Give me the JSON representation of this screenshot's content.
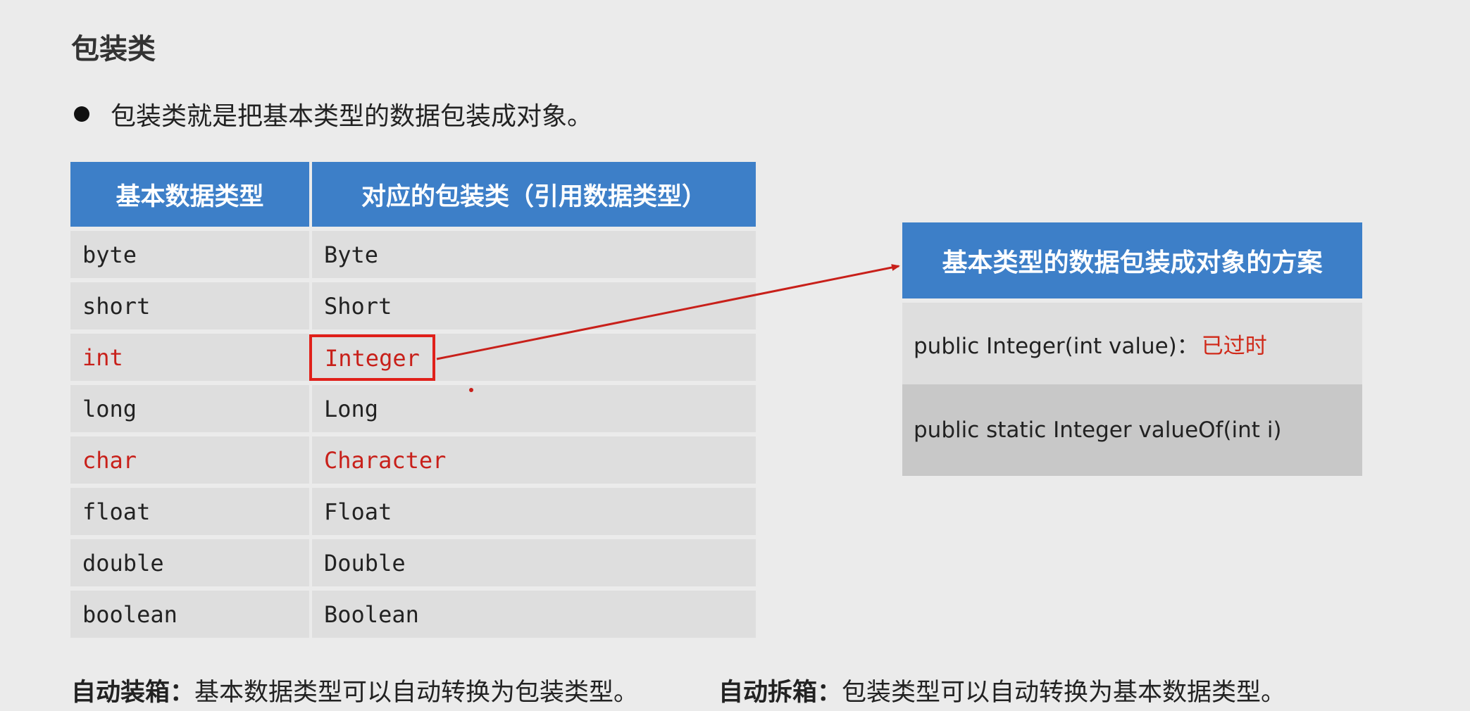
{
  "title": "包装类",
  "bullet": "包装类就是把基本类型的数据包装成对象。",
  "table": {
    "headers": [
      "基本数据类型",
      "对应的包装类（引用数据类型）"
    ],
    "rows": [
      {
        "primitive": "byte",
        "wrapper": "Byte"
      },
      {
        "primitive": "short",
        "wrapper": "Short"
      },
      {
        "primitive": "int",
        "wrapper": "Integer"
      },
      {
        "primitive": "long",
        "wrapper": "Long"
      },
      {
        "primitive": "char",
        "wrapper": "Character"
      },
      {
        "primitive": "float",
        "wrapper": "Float"
      },
      {
        "primitive": "double",
        "wrapper": "Double"
      },
      {
        "primitive": "boolean",
        "wrapper": "Boolean"
      }
    ]
  },
  "scheme": {
    "title": "基本类型的数据包装成对象的方案",
    "row1": "public Integer(int value)：",
    "row1_note": "已过时",
    "row2": "public static Integer valueOf(int i)"
  },
  "footer": {
    "autobox_label": "自动装箱：",
    "autobox_text": "基本数据类型可以自动转换为包装类型。",
    "unbox_label": "自动拆箱：",
    "unbox_text": "包装类型可以自动转换为基本数据类型。"
  },
  "colors": {
    "header_blue": "#3d7fc8",
    "highlight_red": "#c8201a",
    "row_gray": "#dedede",
    "background": "#ebebeb"
  }
}
